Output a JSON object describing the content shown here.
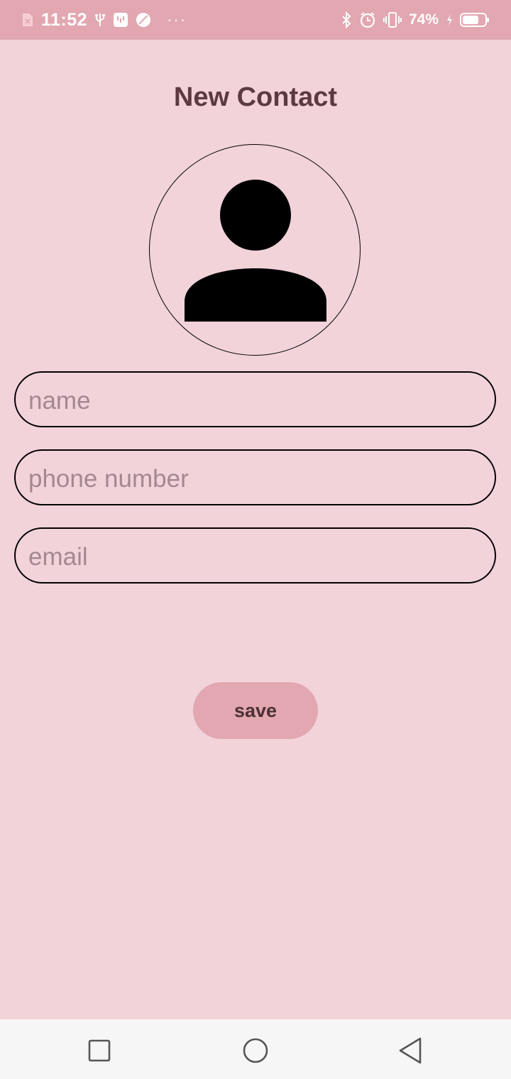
{
  "status_bar": {
    "time": "11:52",
    "battery_percent": "74%",
    "overflow": "···",
    "icons": [
      "sim-off-icon",
      "usb-icon",
      "usb-debug-icon",
      "leaf-icon",
      "bluetooth-icon",
      "alarm-icon",
      "vibrate-icon",
      "charging-icon",
      "battery-icon"
    ]
  },
  "page": {
    "title": "New Contact"
  },
  "avatar": {
    "icon": "person-icon"
  },
  "form": {
    "name_placeholder": "name",
    "phone_placeholder": "phone number",
    "email_placeholder": "email",
    "save_label": "save"
  },
  "nav": {
    "icons": [
      "recents-square-icon",
      "home-circle-icon",
      "back-triangle-icon"
    ]
  },
  "colors": {
    "background": "#f2d3da",
    "status_bar": "#e2a7b0",
    "button": "#e2a7b0",
    "title": "#5d3a40",
    "placeholder": "#a38890"
  }
}
